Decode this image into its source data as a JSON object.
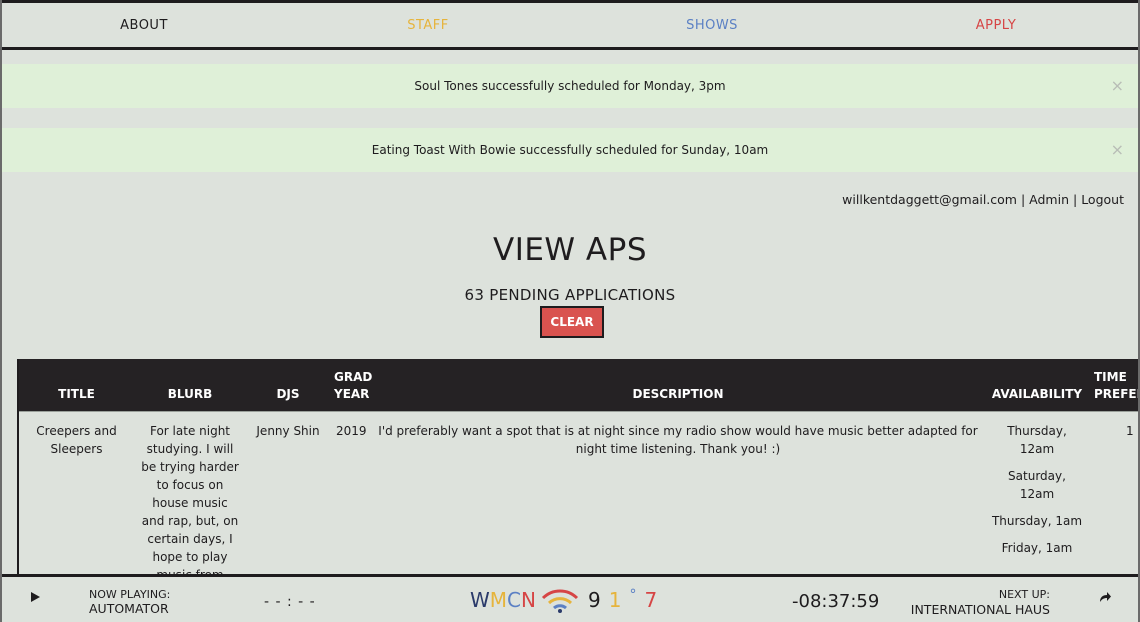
{
  "nav": {
    "about": "ABOUT",
    "staff": "STAFF",
    "shows": "SHOWS",
    "apply": "APPLY",
    "colors": {
      "about": "#1e1c1e",
      "staff": "#e6b43c",
      "shows": "#5b80c4",
      "apply": "#d64545"
    }
  },
  "alerts": [
    {
      "text": "Soul Tones successfully scheduled for Monday, 3pm",
      "close": "×"
    },
    {
      "text": "Eating Toast With Bowie successfully scheduled for Sunday, 10am",
      "close": "×"
    }
  ],
  "user": {
    "email": "willkentdaggett@gmail.com",
    "sep1": "|",
    "admin": "Admin",
    "sep2": "|",
    "logout": "Logout"
  },
  "page": {
    "title": "VIEW APS",
    "pending": "63 PENDING APPLICATIONS",
    "clear_button": "CLEAR"
  },
  "table": {
    "headers": {
      "title": "TITLE",
      "blurb": "BLURB",
      "djs": "DJS",
      "grad_year": "GRAD YEAR",
      "description": "DESCRIPTION",
      "availability": "AVAILABILITY",
      "time_preference": "TIME PREFERENCE"
    },
    "rows": [
      {
        "title": "Creepers and Sleepers",
        "blurb": "For late night studying. I will be trying harder to focus on house music and rap, but, on certain days, I hope to play music from different genres.",
        "djs": "Jenny Shin",
        "grad_year": "2019",
        "description": "I'd preferably want a spot that is at night since my radio show would have music better adapted for night time listening. Thank you! :)",
        "availability": [
          "Thursday, 12am",
          "Saturday, 12am",
          "Thursday, 1am",
          "Friday, 1am"
        ],
        "time_preference": "1"
      }
    ]
  },
  "player": {
    "now_playing_label": "NOW PLAYING:",
    "now_playing": "AUTOMATOR",
    "elapsed": "- - : - -",
    "logo": {
      "w": "W",
      "m": "M",
      "c": "C",
      "n": "N",
      "d9": "9",
      "d1": "1",
      "deg": "°",
      "d7": "7"
    },
    "remaining": "-08:37:59",
    "next_up_label": "NEXT UP:",
    "next_up": "INTERNATIONAL HAUS"
  }
}
